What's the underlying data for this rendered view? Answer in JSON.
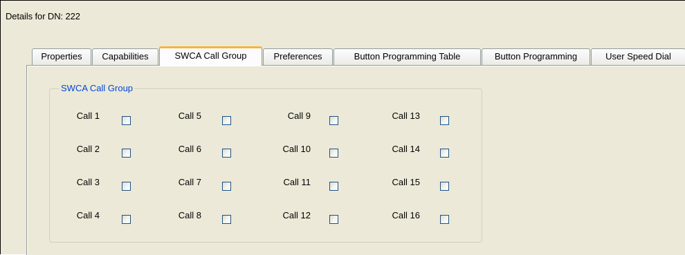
{
  "window": {
    "title": "Details for DN: 222"
  },
  "tabs": [
    {
      "label": "Properties",
      "active": false
    },
    {
      "label": "Capabilities",
      "active": false
    },
    {
      "label": "SWCA Call Group",
      "active": true
    },
    {
      "label": "Preferences",
      "active": false
    },
    {
      "label": "Button Programming Table",
      "active": false
    },
    {
      "label": "Button Programming",
      "active": false
    },
    {
      "label": "User Speed Dial",
      "active": false
    }
  ],
  "group": {
    "legend": "SWCA Call Group",
    "calls": [
      {
        "label": "Call 1",
        "checked": false
      },
      {
        "label": "Call 2",
        "checked": false
      },
      {
        "label": "Call 3",
        "checked": false
      },
      {
        "label": "Call 4",
        "checked": false
      },
      {
        "label": "Call 5",
        "checked": false
      },
      {
        "label": "Call 6",
        "checked": false
      },
      {
        "label": "Call 7",
        "checked": false
      },
      {
        "label": "Call 8",
        "checked": false
      },
      {
        "label": "Call 9",
        "checked": false
      },
      {
        "label": "Call 10",
        "checked": false
      },
      {
        "label": "Call 11",
        "checked": false
      },
      {
        "label": "Call 12",
        "checked": false
      },
      {
        "label": "Call 13",
        "checked": false
      },
      {
        "label": "Call 14",
        "checked": false
      },
      {
        "label": "Call 15",
        "checked": false
      },
      {
        "label": "Call 16",
        "checked": false
      }
    ]
  },
  "colors": {
    "dialog_background": "#ece9d8",
    "legend_text": "#0046d5",
    "active_tab_highlight": "#f8b43a",
    "checkbox_border": "#1c5180"
  }
}
